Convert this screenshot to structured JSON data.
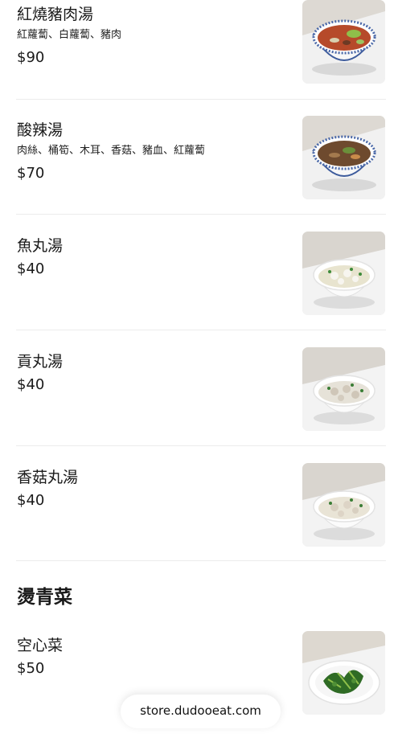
{
  "items": [
    {
      "name": "紅燒豬肉湯",
      "description": "紅蘿蔔、白蘿蔔、豬肉",
      "price": "$90",
      "image": "red-braised-pork-soup"
    },
    {
      "name": "酸辣湯",
      "description": "肉絲、桶筍、木耳、香菇、豬血、紅蘿蔔",
      "price": "$70",
      "image": "hot-and-sour-soup"
    },
    {
      "name": "魚丸湯",
      "price": "$40",
      "image": "fish-ball-soup"
    },
    {
      "name": "貢丸湯",
      "price": "$40",
      "image": "pork-ball-soup"
    },
    {
      "name": "香菇丸湯",
      "price": "$40",
      "image": "mushroom-ball-soup"
    }
  ],
  "section": {
    "title": "燙青菜"
  },
  "section_items": [
    {
      "name": "空心菜",
      "price": "$50",
      "image": "water-spinach"
    }
  ],
  "footer": {
    "store_url": "store.dudooeat.com"
  }
}
